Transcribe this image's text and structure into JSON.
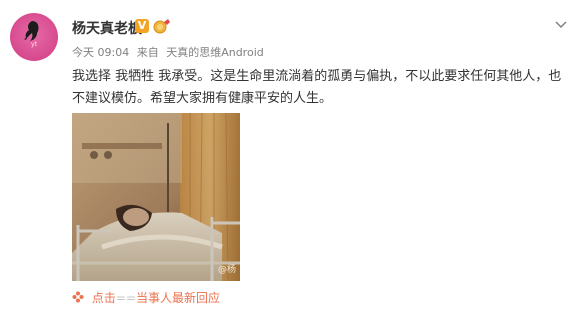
{
  "post": {
    "author": "杨天真老板",
    "avatar_text": "yt",
    "verified_badge": "V",
    "meta": {
      "time": "今天 09:04",
      "via": "来自",
      "source": "天真的思维Android"
    },
    "text": "我选择 我牺牲 我承受。这是生命里流淌着的孤勇与偏执，不以此要求任何其他人，也不建议模仿。希望大家拥有健康平安的人生。",
    "photo_watermark": "@杨",
    "reply_link": {
      "prefix": "点击",
      "bracket": "==",
      "label": "当事人最新回应"
    }
  },
  "colors": {
    "brand_orange": "#eb7350",
    "verified": "#f4a325",
    "text": "#333333",
    "meta": "#808080"
  },
  "icons": {
    "menu": "chevron-down-icon",
    "reply": "flower-icon",
    "medal": "medal-icon"
  }
}
